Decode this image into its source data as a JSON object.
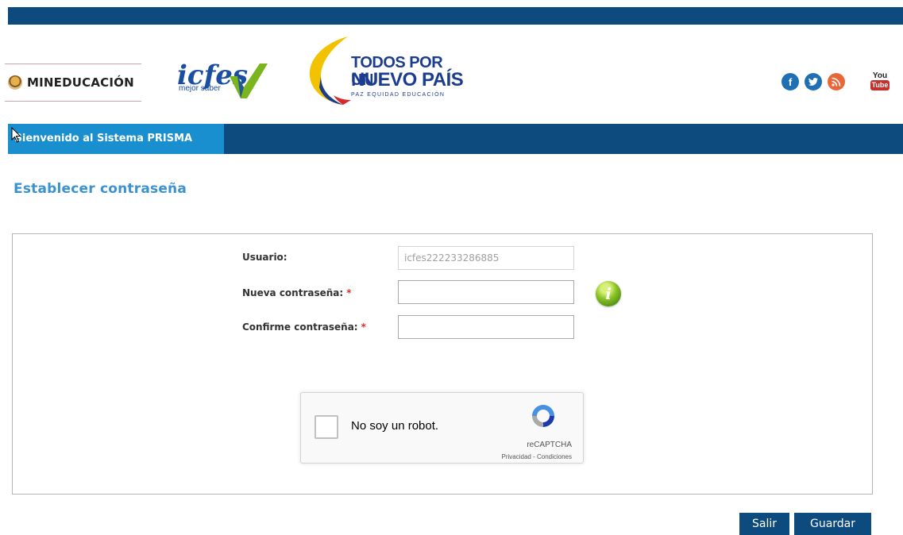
{
  "header": {
    "mineducacion_label": "MINEDUCACIÓN",
    "icfes_label": "icfes",
    "icfes_tagline": "mejor saber",
    "todos_line1": "TODOS POR UN",
    "todos_line2": "NUEVO PAÍS",
    "todos_line3": "PAZ  EQUIDAD  EDUCACIÓN",
    "social": [
      {
        "icon": "facebook-icon",
        "glyph": "f",
        "color": "#1f6fb5"
      },
      {
        "icon": "twitter-icon",
        "glyph": "t",
        "color": "#1f6fb5"
      },
      {
        "icon": "rss-icon",
        "glyph": "r",
        "color": "#e8673a"
      },
      {
        "icon": "youtube-icon",
        "glyph": "You",
        "color": "#c4302b"
      }
    ]
  },
  "nav": {
    "welcome": "Bienvenido al Sistema PRISMA"
  },
  "page": {
    "title": "Establecer contraseña"
  },
  "form": {
    "usuario_label": "Usuario:",
    "usuario_value": "icfes222233286885",
    "nueva_label": "Nueva contraseña:",
    "confirme_label": "Confirme contraseña:",
    "required_mark": "*",
    "nueva_value": "",
    "confirme_value": ""
  },
  "captcha": {
    "label": "No soy un robot.",
    "brand": "reCAPTCHA",
    "links": "Privacidad - Condiciones"
  },
  "buttons": {
    "salir": "Salir",
    "guardar": "Guardar"
  },
  "colors": {
    "brand_dark": "#0d4a7e",
    "brand_light": "#1a8fd0",
    "title": "#3a92d0"
  }
}
